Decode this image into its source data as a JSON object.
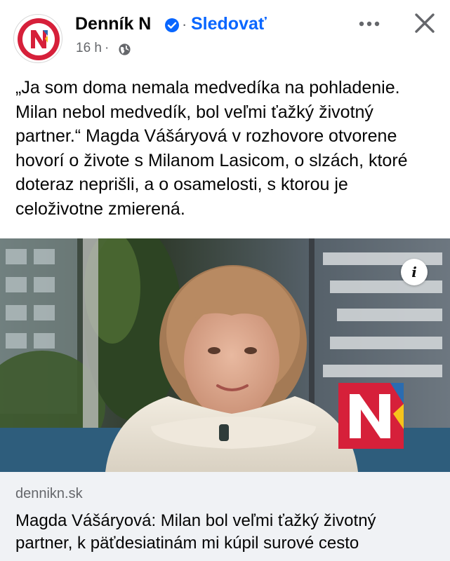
{
  "header": {
    "page_name": "Denník N",
    "separator": "·",
    "follow_label": "Sledovať",
    "timestamp": "16 h",
    "meta_separator": "·",
    "icons": {
      "avatar": "dennik-n-logo",
      "verified": "verified-badge-icon",
      "audience": "globe-icon",
      "more": "more-horizontal-icon",
      "close": "close-icon"
    }
  },
  "post": {
    "text": "„Ja som doma nemala medvedíka na pohladenie. Milan nebol medvedík, bol veľmi ťažký životný partner.“ Magda Vášáryová v rozhovore otvorene hovorí o živote s Milanom Lasicom, o slzách, ktoré doteraz neprišli, a o osamelosti, s ktorou je celoživotne zmierená."
  },
  "media": {
    "info_label": "i",
    "logo": "dennik-n-logo"
  },
  "link_preview": {
    "domain": "dennikn.sk",
    "headline": "Magda Vášáryová: Milan bol veľmi ťažký životný partner, k päťdesiatinám mi kúpil surové cesto"
  },
  "colors": {
    "brand_red": "#d6203a",
    "brand_blue": "#2b6cb0",
    "brand_yellow": "#f6c31b",
    "follow_blue": "#0866ff",
    "verified_blue": "#0866ff",
    "meta_gray": "#65676b",
    "card_bg": "#f0f2f5"
  }
}
